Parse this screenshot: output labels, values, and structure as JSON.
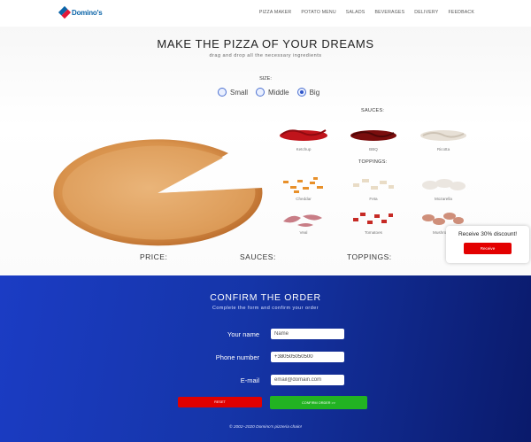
{
  "header": {
    "logo_text": "Domino's",
    "nav": [
      "PIZZA MAKER",
      "POTATO MENU",
      "SALADS",
      "BEVERAGES",
      "DELIVERY",
      "FEEDBACK"
    ]
  },
  "builder": {
    "title": "MAKE THE PIZZA OF YOUR DREAMS",
    "subtitle": "drag and drop all the necessary ingredients",
    "size_label": "SIZE:",
    "sizes": [
      {
        "label": "Small",
        "selected": false
      },
      {
        "label": "Middle",
        "selected": false
      },
      {
        "label": "Big",
        "selected": true
      }
    ],
    "sauces_label": "SAUCES:",
    "sauces": [
      {
        "name": "Ketchup",
        "color": "#c0141b"
      },
      {
        "name": "BBQ",
        "color": "#7a0d0d"
      },
      {
        "name": "Ricotta",
        "color": "#e7e0d6"
      }
    ],
    "toppings_label": "TOPPINGS:",
    "toppings": [
      {
        "name": "Cheddar",
        "color": "#e8902a"
      },
      {
        "name": "Feta",
        "color": "#efe4d2"
      },
      {
        "name": "Mozarella",
        "color": "#eeeae6"
      },
      {
        "name": "Veal",
        "color": "#c87d86"
      },
      {
        "name": "Tomatoes",
        "color": "#c62a25"
      },
      {
        "name": "Mushrooms",
        "color": "#cf8f7a"
      }
    ]
  },
  "summary": {
    "price_label": "PRICE:",
    "sauces_label": "SAUCES:",
    "toppings_label": "TOPPINGS:"
  },
  "discount": {
    "text": "Receive 30% discount!",
    "button": "Receive"
  },
  "order": {
    "title": "CONFIRM THE ORDER",
    "subtitle": "Complete the form and confirm your order",
    "fields": {
      "name": {
        "label": "Your name",
        "placeholder": "Name"
      },
      "phone": {
        "label": "Phone number",
        "value": "+380505050500"
      },
      "email": {
        "label": "E-mail",
        "placeholder": "email@domain.com"
      }
    },
    "reset_button": "RESET",
    "confirm_button": "CONFIRM ORDER >>",
    "footer": "© 2002–2020 Domino's pizzeria chain!"
  },
  "colors": {
    "accent_blue": "#1b3cc4",
    "reset_red": "#e00000",
    "confirm_green": "#22b322",
    "discount_red": "#e30000"
  }
}
